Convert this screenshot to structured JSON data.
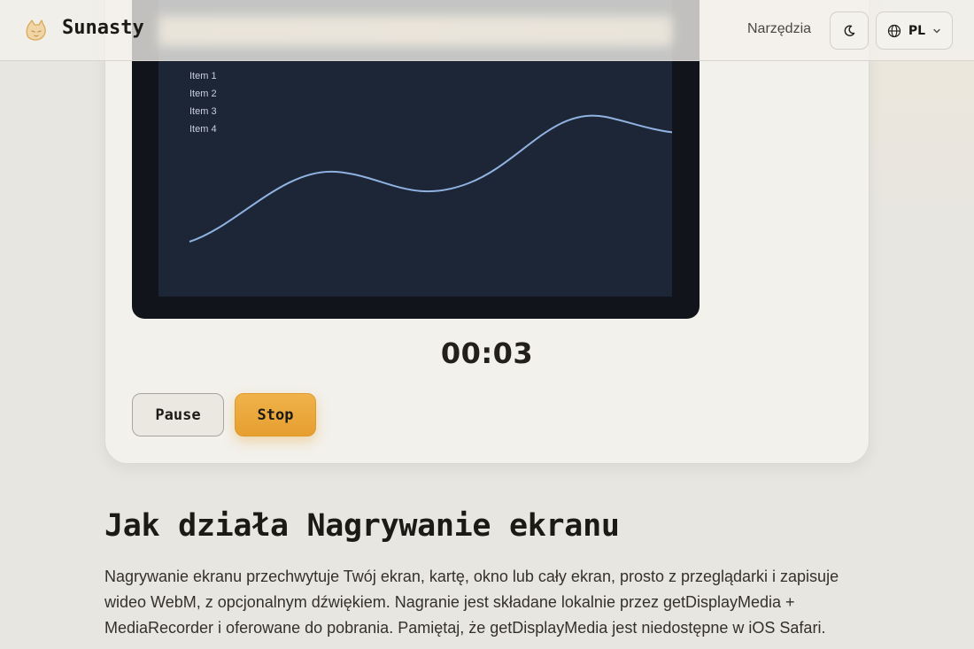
{
  "header": {
    "brand": "Sunasty",
    "nav_tools": "Narzędzia",
    "language": "PL"
  },
  "preview": {
    "items": [
      "Item 1",
      "Item 2",
      "Item 3",
      "Item 4"
    ]
  },
  "recorder": {
    "timer": "00:03",
    "pause_label": "Pause",
    "stop_label": "Stop"
  },
  "article": {
    "title": "Jak działa Nagrywanie ekranu",
    "body": "Nagrywanie ekranu przechwytuje Twój ekran, kartę, okno lub cały ekran, prosto z przeglądarki i zapisuje wideo WebM, z opcjonalnym dźwiękiem. Nagranie jest składane lokalnie przez getDisplayMedia + MediaRecorder i oferowane do pobrania. Pamiętaj, że getDisplayMedia jest niedostępne w iOS Safari."
  },
  "colors": {
    "accent": "#e9a63a",
    "background": "#e8e6e1",
    "card": "#f3f1ec",
    "preview_bg": "#1d2636",
    "preview_line": "#8fb2e0"
  }
}
